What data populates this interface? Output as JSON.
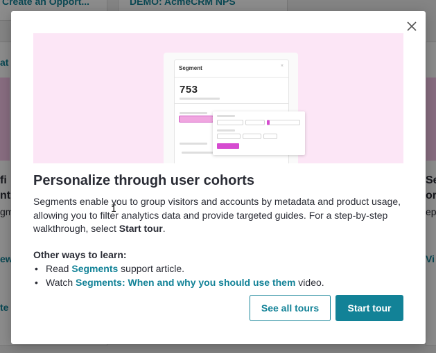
{
  "background": {
    "card_top_left_link": "Create an Opport...",
    "card_top_mid_link": "DEMO: AcmeCRM NPS",
    "left_snippets": [
      "at",
      "fi",
      "nt",
      "gm",
      "ew",
      "te"
    ],
    "right_snippets": [
      "Se",
      "or",
      "ep",
      "Vi"
    ]
  },
  "modal": {
    "close_label": "×",
    "hero": {
      "card_title": "Segment",
      "card_count": "753"
    },
    "title": "Personalize through user cohorts",
    "body_text": "Segments enable you to group visitors and accounts by metadata and product usage, allowing you to filter analytics data and provide targeted guides. For a step-by-step walkthrough, select ",
    "body_emphasis": "Start tour",
    "body_end": ".",
    "other_ways_heading": "Other ways to learn:",
    "list": [
      {
        "prefix": "Read ",
        "link": "Segments",
        "suffix": " support article."
      },
      {
        "prefix": "Watch ",
        "link": "Segments: When and why you should use them",
        "suffix": " video."
      }
    ],
    "buttons": {
      "secondary": "See all tours",
      "primary": "Start tour"
    }
  },
  "colors": {
    "accent": "#128297",
    "hero_bg": "#fce6f6",
    "magenta": "#d64bd0"
  }
}
